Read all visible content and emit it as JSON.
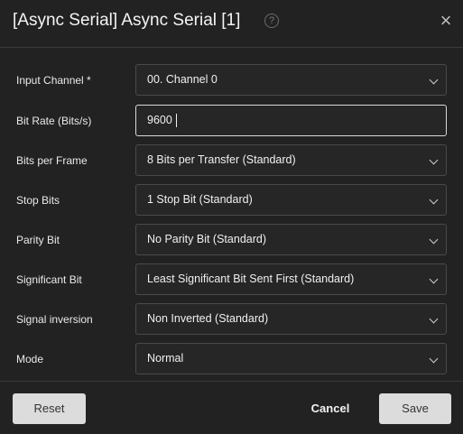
{
  "dialog": {
    "title": "[Async Serial] Async Serial [1]",
    "help_icon": "?",
    "close_icon": "×"
  },
  "fields": [
    {
      "label": "Input Channel *",
      "value": "00.  Channel 0",
      "type": "select"
    },
    {
      "label": "Bit Rate (Bits/s)",
      "value": "9600",
      "type": "input"
    },
    {
      "label": "Bits per Frame",
      "value": "8 Bits per Transfer (Standard)",
      "type": "select"
    },
    {
      "label": "Stop Bits",
      "value": "1 Stop Bit (Standard)",
      "type": "select"
    },
    {
      "label": "Parity Bit",
      "value": "No Parity Bit (Standard)",
      "type": "select"
    },
    {
      "label": "Significant Bit",
      "value": "Least Significant Bit Sent First (Standard)",
      "type": "select"
    },
    {
      "label": "Signal inversion",
      "value": "Non Inverted (Standard)",
      "type": "select"
    },
    {
      "label": "Mode",
      "value": "Normal",
      "type": "select"
    }
  ],
  "footer": {
    "reset_label": "Reset",
    "cancel_label": "Cancel",
    "save_label": "Save"
  }
}
